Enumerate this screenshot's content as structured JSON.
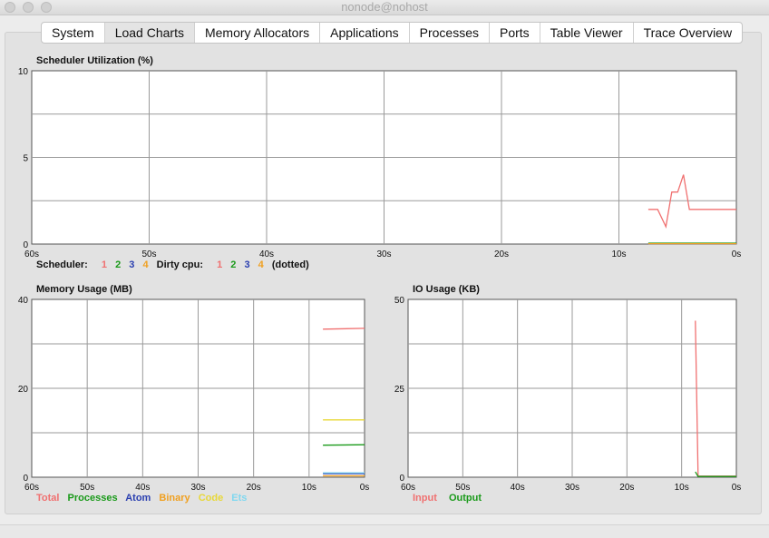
{
  "window": {
    "title": "nonode@nohost"
  },
  "tabs": [
    "System",
    "Load Charts",
    "Memory Allocators",
    "Applications",
    "Processes",
    "Ports",
    "Table Viewer",
    "Trace Overview"
  ],
  "active_tab": "Load Charts",
  "scheduler_legend": {
    "label": "Scheduler:",
    "items": [
      {
        "text": "1",
        "color": "#f07070"
      },
      {
        "text": "2",
        "color": "#1a9a1a"
      },
      {
        "text": "3",
        "color": "#2a3fb0"
      },
      {
        "text": "4",
        "color": "#f0a020"
      }
    ],
    "dirty_label": "Dirty cpu:",
    "dirty_items": [
      {
        "text": "1",
        "color": "#f07070"
      },
      {
        "text": "2",
        "color": "#1a9a1a"
      },
      {
        "text": "3",
        "color": "#2a3fb0"
      },
      {
        "text": "4",
        "color": "#f0a020"
      }
    ],
    "suffix": "(dotted)"
  },
  "memory_legend": [
    {
      "text": "Total",
      "color": "#f07070"
    },
    {
      "text": "Processes",
      "color": "#1a9a1a"
    },
    {
      "text": "Atom",
      "color": "#2a3fb0"
    },
    {
      "text": "Binary",
      "color": "#f0a020"
    },
    {
      "text": "Code",
      "color": "#e8d838"
    },
    {
      "text": "Ets",
      "color": "#80d8f0"
    }
  ],
  "io_legend": [
    {
      "text": "Input",
      "color": "#f07070"
    },
    {
      "text": "Output",
      "color": "#1a9a1a"
    }
  ],
  "chart_data": [
    {
      "type": "line",
      "title": "Scheduler Utilization (%)",
      "xlabel": "",
      "ylabel": "",
      "xlim": [
        60,
        0
      ],
      "ylim": [
        0,
        10
      ],
      "x_ticks": [
        "60s",
        "50s",
        "40s",
        "30s",
        "20s",
        "10s",
        "0s"
      ],
      "y_ticks": [
        "0",
        "5",
        "10"
      ],
      "grid": true,
      "series": [
        {
          "name": "1",
          "color": "#f07070",
          "x": [
            7.5,
            6.7,
            6.0,
            5.5,
            5.0,
            4.5,
            4.0,
            3.5,
            2.0,
            0
          ],
          "y": [
            2,
            2,
            1,
            3,
            3,
            4,
            2,
            2,
            2,
            2
          ]
        },
        {
          "name": "2",
          "color": "#1a9a1a",
          "x": [
            7.5,
            0
          ],
          "y": [
            0.05,
            0.05
          ]
        },
        {
          "name": "3",
          "color": "#2a3fb0",
          "x": [
            7.5,
            0
          ],
          "y": [
            0.02,
            0.02
          ]
        },
        {
          "name": "4",
          "color": "#f0a020",
          "x": [
            7.5,
            0
          ],
          "y": [
            0.02,
            0.02
          ]
        }
      ]
    },
    {
      "type": "line",
      "title": "Memory Usage (MB)",
      "xlabel": "",
      "ylabel": "",
      "xlim": [
        60,
        0
      ],
      "ylim": [
        0,
        40
      ],
      "x_ticks": [
        "60s",
        "50s",
        "40s",
        "30s",
        "20s",
        "10s",
        "0s"
      ],
      "y_ticks": [
        "0",
        "20",
        "40"
      ],
      "grid": true,
      "series": [
        {
          "name": "Total",
          "color": "#f07070",
          "x": [
            7.5,
            0
          ],
          "y": [
            33.3,
            33.5
          ]
        },
        {
          "name": "Processes",
          "color": "#1a9a1a",
          "x": [
            7.5,
            0
          ],
          "y": [
            7.2,
            7.3
          ]
        },
        {
          "name": "Atom",
          "color": "#2a3fb0",
          "x": [
            7.5,
            0
          ],
          "y": [
            0.8,
            0.8
          ]
        },
        {
          "name": "Binary",
          "color": "#f0a020",
          "x": [
            7.5,
            0
          ],
          "y": [
            0.3,
            0.3
          ]
        },
        {
          "name": "Code",
          "color": "#e8d838",
          "x": [
            7.5,
            0
          ],
          "y": [
            12.9,
            12.9
          ]
        },
        {
          "name": "Ets",
          "color": "#80d8f0",
          "x": [
            7.5,
            0
          ],
          "y": [
            1.0,
            1.0
          ]
        }
      ]
    },
    {
      "type": "line",
      "title": "IO Usage (KB)",
      "xlabel": "",
      "ylabel": "",
      "xlim": [
        60,
        0
      ],
      "ylim": [
        0,
        50
      ],
      "x_ticks": [
        "60s",
        "50s",
        "40s",
        "30s",
        "20s",
        "10s",
        "0s"
      ],
      "y_ticks": [
        "0",
        "25",
        "50"
      ],
      "grid": true,
      "series": [
        {
          "name": "Input",
          "color": "#f07070",
          "x": [
            7.5,
            7.0,
            6.5,
            0
          ],
          "y": [
            44,
            0.3,
            0.3,
            0.3
          ]
        },
        {
          "name": "Output",
          "color": "#1a9a1a",
          "x": [
            7.5,
            7.0,
            6.5,
            0
          ],
          "y": [
            1.5,
            0.2,
            0.2,
            0.2
          ]
        }
      ]
    }
  ]
}
